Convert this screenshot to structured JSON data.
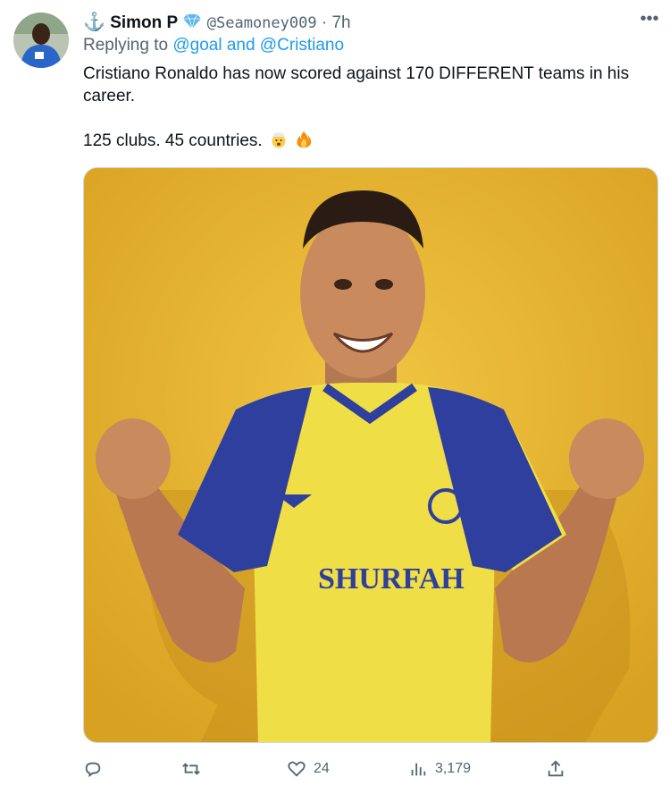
{
  "tweet": {
    "author_prefix_icon": "anchor-icon",
    "author_name": "Simon P",
    "verified_icon": "diamond-icon",
    "handle": "@Seamoney009",
    "separator": "·",
    "time": "7h",
    "reply_prefix": "Replying to",
    "reply_mentions": "@goal and @Cristiano",
    "text_line1": "Cristiano Ronaldo has now scored against 170 DIFFERENT teams in his career.",
    "text_line2": "125 clubs. 45 countries.",
    "emojis": [
      "exploding-head-icon",
      "fire-icon"
    ],
    "media": {
      "icon": "photo-icon",
      "sponsor_text": "SHURFAH",
      "colors": {
        "background": "#e9b62d",
        "jersey": "#f3e04a",
        "sleeves": "#2f3f9e"
      }
    }
  },
  "actions": {
    "reply_icon": "reply-icon",
    "retweet_icon": "retweet-icon",
    "like_icon": "heart-icon",
    "like_count": "24",
    "views_icon": "views-chart-icon",
    "view_count": "3,179",
    "share_icon": "share-icon"
  },
  "colors": {
    "link": "#1d9bf0",
    "muted": "#536471",
    "text": "#0f1419"
  }
}
